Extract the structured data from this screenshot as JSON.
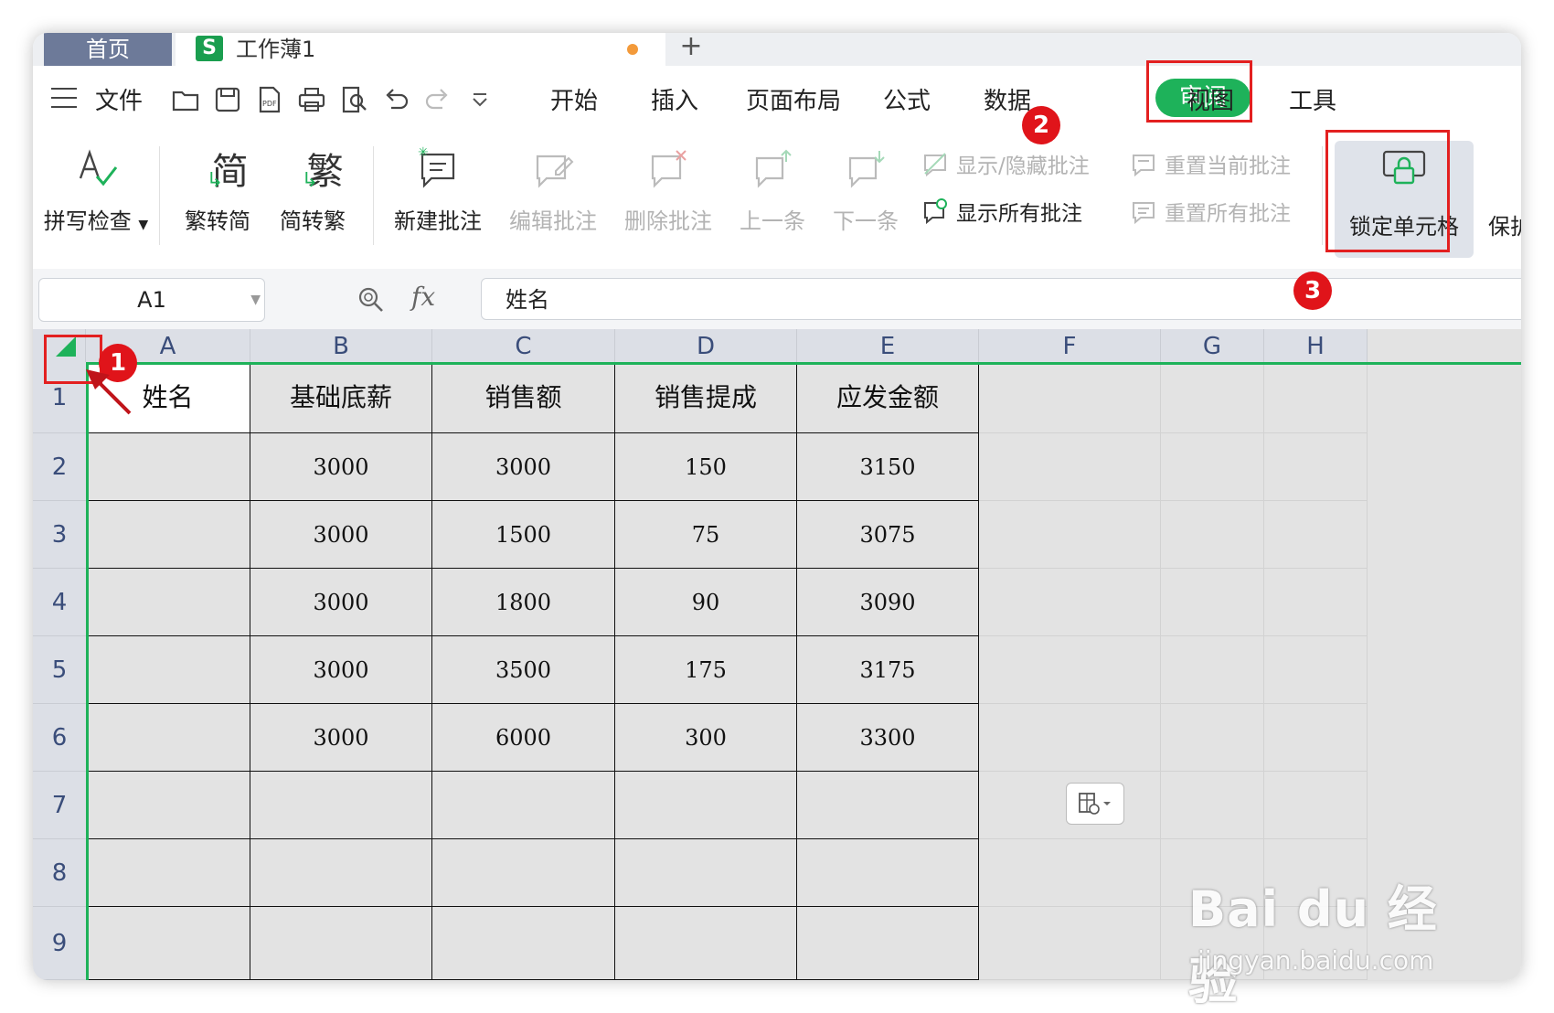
{
  "tabs": {
    "home": "首页",
    "doc_title": "工作薄1",
    "add": "+"
  },
  "menu": {
    "file": "文件",
    "items": [
      "开始",
      "插入",
      "页面布局",
      "公式",
      "数据",
      "审阅",
      "视图",
      "工具"
    ]
  },
  "ribbon": {
    "spell_check": "拼写检查",
    "trad_to_simp": "繁转简",
    "simp_to_trad": "简转繁",
    "trad_glyph": "繁",
    "simp_glyph": "简",
    "new_comment": "新建批注",
    "edit_comment": "编辑批注",
    "delete_comment": "删除批注",
    "prev": "上一条",
    "next": "下一条",
    "show_hide_comment": "显示/隐藏批注",
    "show_all_comments": "显示所有批注",
    "reset_current_comment": "重置当前批注",
    "reset_all_comments": "重置所有批注",
    "lock_cells": "锁定单元格",
    "protect": "保护"
  },
  "formula_bar": {
    "cell_ref": "A1",
    "fx": "fx",
    "value": "姓名"
  },
  "columns": [
    "A",
    "B",
    "C",
    "D",
    "E",
    "F",
    "G",
    "H"
  ],
  "rows": [
    "1",
    "2",
    "3",
    "4",
    "5",
    "6",
    "7",
    "8",
    "9"
  ],
  "table": [
    [
      "姓名",
      "基础底薪",
      "销售额",
      "销售提成",
      "应发金额"
    ],
    [
      "",
      "3000",
      "3000",
      "150",
      "3150"
    ],
    [
      "",
      "3000",
      "1500",
      "75",
      "3075"
    ],
    [
      "",
      "3000",
      "1800",
      "90",
      "3090"
    ],
    [
      "",
      "3000",
      "3500",
      "175",
      "3175"
    ],
    [
      "",
      "3000",
      "6000",
      "300",
      "3300"
    ],
    [
      "",
      "",
      "",
      "",
      ""
    ],
    [
      "",
      "",
      "",
      "",
      ""
    ],
    [
      "",
      "",
      "",
      "",
      ""
    ]
  ],
  "badges": [
    "1",
    "2",
    "3"
  ],
  "watermark": {
    "brand": "Bai du 经验",
    "url": "jingyan.baidu.com"
  },
  "colors": {
    "accent_green": "#1eb25a",
    "annotation_red": "#e32020",
    "sheet_gray": "#e3e3e3"
  }
}
